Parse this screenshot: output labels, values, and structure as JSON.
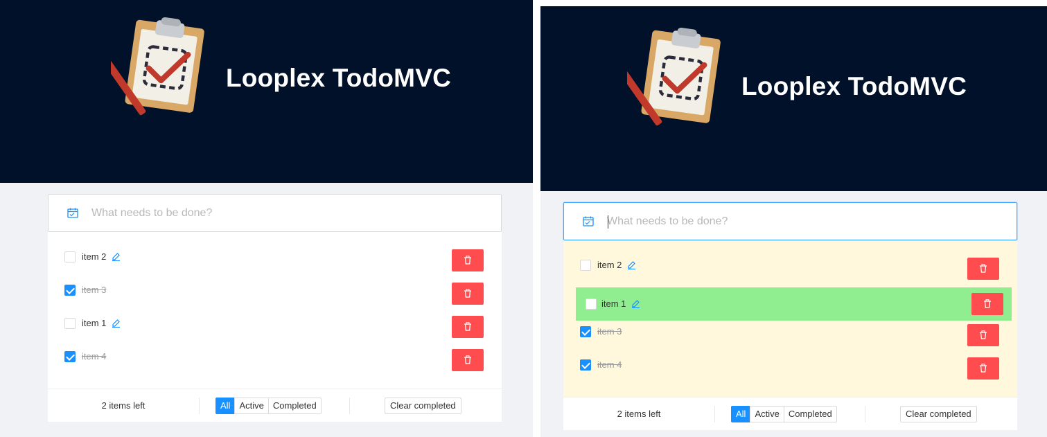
{
  "left": {
    "header": {
      "title": "Looplex TodoMVC"
    },
    "new_todo": {
      "placeholder": "What needs to be done?",
      "value": ""
    },
    "todos": [
      {
        "label": "item 2",
        "completed": false
      },
      {
        "label": "item 3",
        "completed": true
      },
      {
        "label": "item 1",
        "completed": false
      },
      {
        "label": "item 4",
        "completed": true
      }
    ],
    "footer": {
      "items_left": "2 items left",
      "filters": [
        "All",
        "Active",
        "Completed"
      ],
      "active_filter": "All",
      "clear_label": "Clear completed"
    }
  },
  "right": {
    "header": {
      "title": "Looplex TodoMVC"
    },
    "new_todo": {
      "placeholder": "What needs to be done?",
      "value": "",
      "focused": true
    },
    "todos": [
      {
        "label": "item 2",
        "completed": false
      },
      {
        "label": "item 3",
        "completed": true
      },
      {
        "label": "item 4",
        "completed": true
      }
    ],
    "dragging_item": {
      "label": "item 1",
      "completed": false
    },
    "footer": {
      "items_left": "2 items left",
      "filters": [
        "All",
        "Active",
        "Completed"
      ],
      "active_filter": "All",
      "clear_label": "Clear completed"
    }
  },
  "colors": {
    "header_bg": "#001129",
    "accent": "#1890ff",
    "danger": "#ff4d4f",
    "drop_zone": "#fff8dc",
    "dragging_row": "#90ee90"
  },
  "icons": {
    "logo": "clipboard-check-logo",
    "input": "calendar-icon",
    "edit": "pencil-icon",
    "delete": "trash-icon"
  }
}
